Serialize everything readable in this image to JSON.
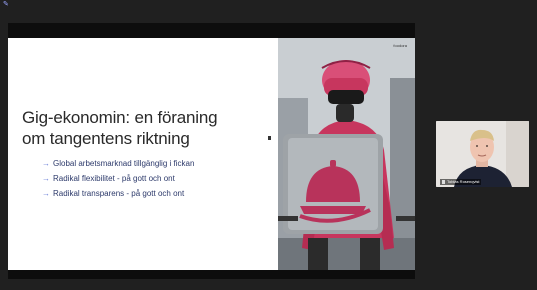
{
  "app": {
    "icon": "meeting-app-icon"
  },
  "slide": {
    "title_line1": "Gig-ekonomin: en föraning",
    "title_line2": "om tangentens riktning",
    "bullets": [
      "Global arbetsmarknad tillgänglig i fickan",
      "Radikal flexibilitet - på gott och ont",
      "Radikal transparens - på gott och ont"
    ],
    "photo_logo": "foodora"
  },
  "participant": {
    "name": "Tobias Rosenqvist",
    "icon": "mic-icon"
  },
  "colors": {
    "accent": "#6b7fd9",
    "bullet_text": "#2d3a6b",
    "jacket": "#c7365e",
    "background": "#202020"
  }
}
